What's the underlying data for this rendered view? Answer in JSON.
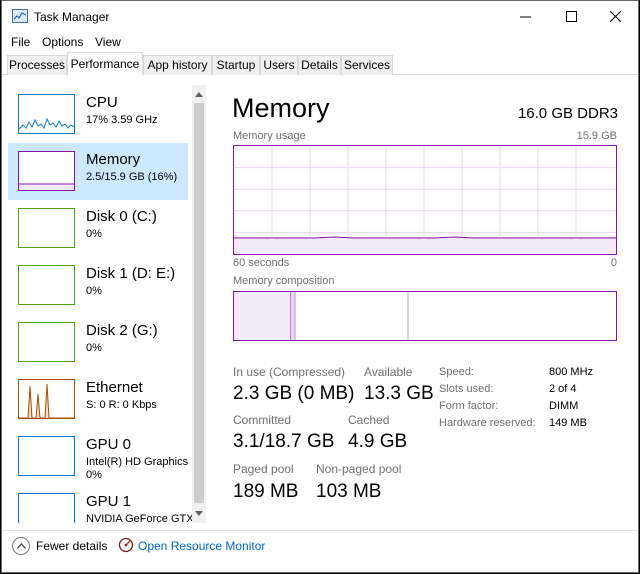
{
  "window": {
    "title": "Task Manager"
  },
  "menu": [
    "File",
    "Options",
    "View"
  ],
  "tabs": [
    "Processes",
    "Performance",
    "App history",
    "Startup",
    "Users",
    "Details",
    "Services"
  ],
  "resources": [
    {
      "name": "CPU",
      "sub": "17%  3.59 GHz",
      "sub2": ""
    },
    {
      "name": "Memory",
      "sub": "2.5/15.9 GB (16%)",
      "sub2": ""
    },
    {
      "name": "Disk 0 (C:)",
      "sub": "0%",
      "sub2": ""
    },
    {
      "name": "Disk 1 (D: E:)",
      "sub": "0%",
      "sub2": ""
    },
    {
      "name": "Disk 2 (G:)",
      "sub": "0%",
      "sub2": ""
    },
    {
      "name": "Ethernet",
      "sub": "S: 0  R: 0 Kbps",
      "sub2": ""
    },
    {
      "name": "GPU 0",
      "sub": "Intel(R) HD Graphics",
      "sub2": "0%"
    },
    {
      "name": "GPU 1",
      "sub": "NVIDIA GeForce GTX",
      "sub2": ""
    }
  ],
  "memory": {
    "title": "Memory",
    "spec": "16.0 GB DDR3",
    "usage_label": "Memory usage",
    "usage_max": "15.9 GB",
    "time_left": "60 seconds",
    "time_right": "0",
    "composition_label": "Memory composition",
    "stats": {
      "in_use_label": "In use (Compressed)",
      "in_use_value": "2.3 GB (0 MB)",
      "available_label": "Available",
      "available_value": "13.3 GB",
      "committed_label": "Committed",
      "committed_value": "3.1/18.7 GB",
      "cached_label": "Cached",
      "cached_value": "4.9 GB",
      "paged_label": "Paged pool",
      "paged_value": "189 MB",
      "nonpaged_label": "Non-paged pool",
      "nonpaged_value": "103 MB"
    },
    "details": [
      {
        "label": "Speed:",
        "value": "800 MHz"
      },
      {
        "label": "Slots used:",
        "value": "2 of 4"
      },
      {
        "label": "Form factor:",
        "value": "DIMM"
      },
      {
        "label": "Hardware reserved:",
        "value": "149 MB"
      }
    ]
  },
  "footer": {
    "fewer_details": "Fewer details",
    "resource_monitor": "Open Resource Monitor"
  },
  "colors": {
    "cpu": "#117dbb",
    "memory": "#8b12ae",
    "disk": "#4da60c",
    "ethernet": "#a74f01",
    "gpu": "#0078d7",
    "selected": "#cce8ff",
    "link": "#0066cc"
  }
}
